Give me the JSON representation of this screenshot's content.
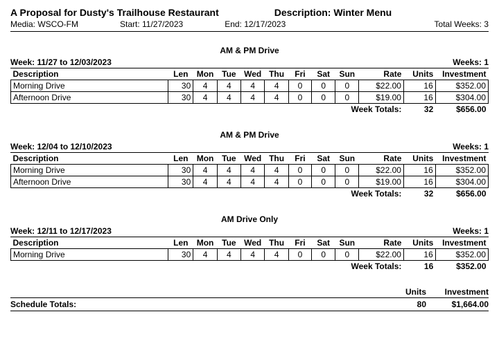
{
  "header": {
    "title": "A Proposal for Dusty's Trailhouse Restaurant",
    "desc_label": "Description: Winter Menu",
    "media_label": "Media: WSCO-FM",
    "start_label": "Start: 11/27/2023",
    "end_label": "End: 12/17/2023",
    "total_weeks_label": "Total Weeks: 3"
  },
  "cols": {
    "description": "Description",
    "len": "Len",
    "mon": "Mon",
    "tue": "Tue",
    "wed": "Wed",
    "thu": "Thu",
    "fri": "Fri",
    "sat": "Sat",
    "sun": "Sun",
    "rate": "Rate",
    "units": "Units",
    "investment": "Investment"
  },
  "week_totals_label": "Week Totals:",
  "sections": [
    {
      "title": "AM & PM Drive",
      "week_range": "Week: 11/27 to 12/03/2023",
      "weeks_label": "Weeks: 1",
      "rows": [
        {
          "desc": "Morning Drive",
          "len": "30",
          "mon": "4",
          "tue": "4",
          "wed": "4",
          "thu": "4",
          "fri": "0",
          "sat": "0",
          "sun": "0",
          "rate": "$22.00",
          "units": "16",
          "inv": "$352.00"
        },
        {
          "desc": "Afternoon Drive",
          "len": "30",
          "mon": "4",
          "tue": "4",
          "wed": "4",
          "thu": "4",
          "fri": "0",
          "sat": "0",
          "sun": "0",
          "rate": "$19.00",
          "units": "16",
          "inv": "$304.00"
        }
      ],
      "totals": {
        "units": "32",
        "inv": "$656.00"
      }
    },
    {
      "title": "AM & PM Drive",
      "week_range": "Week: 12/04 to 12/10/2023",
      "weeks_label": "Weeks: 1",
      "rows": [
        {
          "desc": "Morning Drive",
          "len": "30",
          "mon": "4",
          "tue": "4",
          "wed": "4",
          "thu": "4",
          "fri": "0",
          "sat": "0",
          "sun": "0",
          "rate": "$22.00",
          "units": "16",
          "inv": "$352.00"
        },
        {
          "desc": "Afternoon Drive",
          "len": "30",
          "mon": "4",
          "tue": "4",
          "wed": "4",
          "thu": "4",
          "fri": "0",
          "sat": "0",
          "sun": "0",
          "rate": "$19.00",
          "units": "16",
          "inv": "$304.00"
        }
      ],
      "totals": {
        "units": "32",
        "inv": "$656.00"
      }
    },
    {
      "title": "AM Drive Only",
      "week_range": "Week: 12/11 to 12/17/2023",
      "weeks_label": "Weeks: 1",
      "rows": [
        {
          "desc": "Morning Drive",
          "len": "30",
          "mon": "4",
          "tue": "4",
          "wed": "4",
          "thu": "4",
          "fri": "0",
          "sat": "0",
          "sun": "0",
          "rate": "$22.00",
          "units": "16",
          "inv": "$352.00"
        }
      ],
      "totals": {
        "units": "16",
        "inv": "$352.00"
      }
    }
  ],
  "footer": {
    "units_hdr": "Units",
    "inv_hdr": "Investment",
    "label": "Schedule Totals:",
    "units": "80",
    "inv": "$1,664.00"
  }
}
